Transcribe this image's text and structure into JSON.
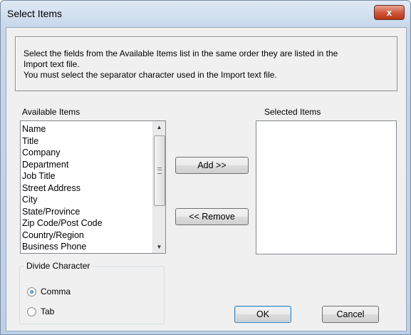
{
  "window": {
    "title": "Select Items",
    "close_label": "x"
  },
  "info": {
    "line1": "Select the fields from the Available Items list in the same order they are listed in the",
    "line2": "Import text file.",
    "line3": "You must select the separator character used in the Import text file."
  },
  "available": {
    "label": "Available Items",
    "items": [
      "Name",
      "Title",
      "Company",
      "Department",
      "Job Title",
      "Street Address",
      "City",
      "State/Province",
      "Zip Code/Post Code",
      "Country/Region",
      "Business Phone"
    ]
  },
  "selected": {
    "label": "Selected Items",
    "items": []
  },
  "buttons": {
    "add": "Add >>",
    "remove": "<< Remove",
    "ok": "OK",
    "cancel": "Cancel"
  },
  "divide": {
    "title": "Divide Character",
    "options": [
      {
        "label": "Comma",
        "checked": true
      },
      {
        "label": "Tab",
        "checked": false
      }
    ]
  },
  "icons": {
    "close": "close-icon",
    "scroll_up": "up-arrow-icon",
    "scroll_down": "down-arrow-icon"
  }
}
